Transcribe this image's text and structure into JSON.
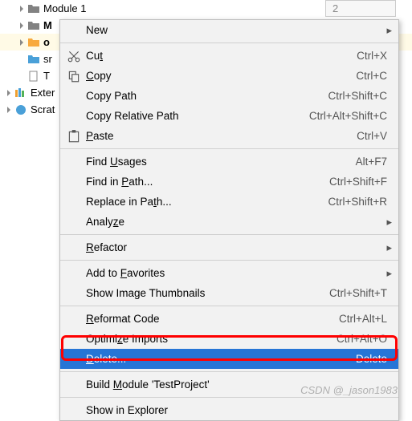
{
  "gutter": {
    "num": "2"
  },
  "tree": {
    "item0": "Module 1",
    "item1": "M",
    "item2": "o",
    "item3": "sr",
    "item4": "T",
    "item5": "Exter",
    "item6": "Scrat"
  },
  "menu": {
    "new": "New",
    "cut": {
      "label": "Cut",
      "m": "t",
      "shortcut": "Ctrl+X"
    },
    "copy": {
      "label": "Copy",
      "m": "C",
      "shortcut": "Ctrl+C"
    },
    "copyPath": {
      "label": "Copy Path",
      "shortcut": "Ctrl+Shift+C"
    },
    "copyRel": {
      "label": "Copy Relative Path",
      "shortcut": "Ctrl+Alt+Shift+C"
    },
    "paste": {
      "label": "Paste",
      "m": "P",
      "shortcut": "Ctrl+V"
    },
    "findUsages": {
      "label": "Find Usages",
      "m": "U",
      "shortcut": "Alt+F7"
    },
    "findInPath": {
      "label": "Find in Path...",
      "m": "P",
      "shortcut": "Ctrl+Shift+F"
    },
    "replaceInPath": {
      "label": "Replace in Path...",
      "m": "t",
      "shortcut": "Ctrl+Shift+R"
    },
    "analyze": {
      "label": "Analyze",
      "m": "z"
    },
    "refactor": {
      "label": "Refactor",
      "m": "R"
    },
    "favorites": {
      "label": "Add to Favorites",
      "m": "F"
    },
    "thumbnails": {
      "label": "Show Image Thumbnails",
      "shortcut": "Ctrl+Shift+T"
    },
    "reformat": {
      "label": "Reformat Code",
      "m": "R",
      "shortcut": "Ctrl+Alt+L"
    },
    "optimize": {
      "label": "Optimize Imports",
      "m": "z",
      "shortcut": "Ctrl+Alt+O"
    },
    "delete": {
      "label": "Delete...",
      "m": "D",
      "shortcut": "Delete"
    },
    "build": {
      "label": "Build Module 'TestProject'",
      "m": "M"
    },
    "explorer": {
      "label": "Show in Explorer"
    }
  },
  "watermark": "CSDN @_jason1983"
}
